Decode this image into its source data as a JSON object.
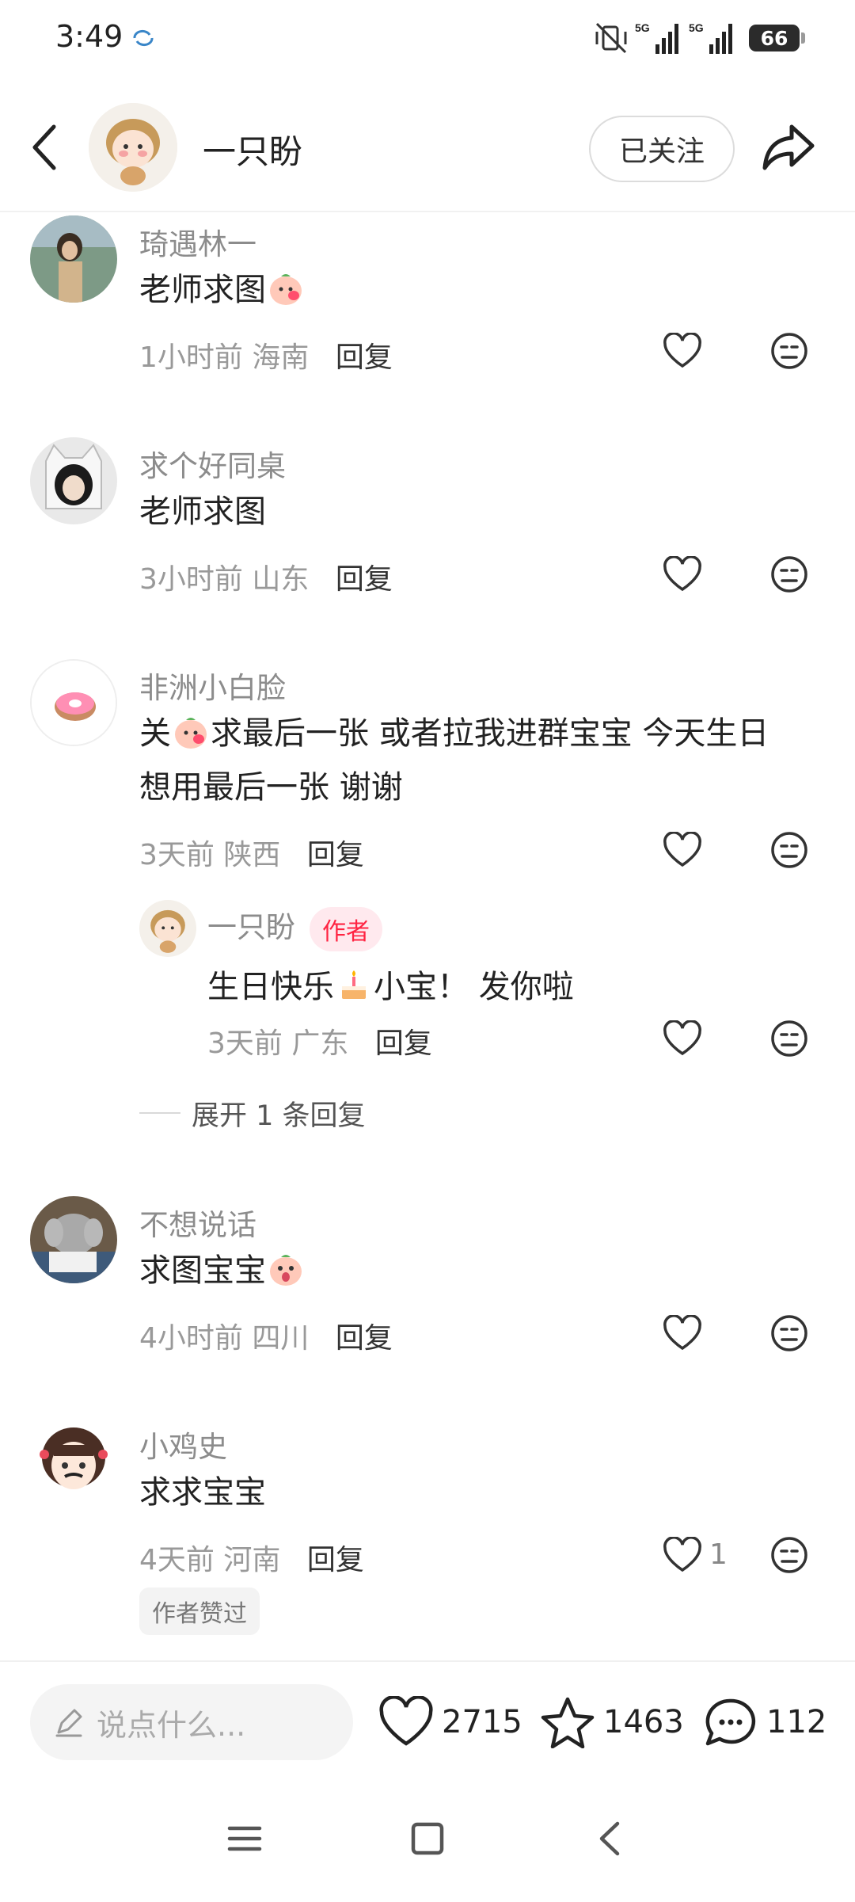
{
  "status_bar": {
    "time": "3:49",
    "battery": "66",
    "network": "5G"
  },
  "header": {
    "author_name": "一只盼",
    "follow_label": "已关注"
  },
  "comments": [
    {
      "name": "琦遇林一",
      "text": "老师求图",
      "time": "1小时前",
      "location": "海南",
      "reply": "回复"
    },
    {
      "name": "求个好同桌",
      "text": "老师求图",
      "time": "3小时前",
      "location": "山东",
      "reply": "回复"
    },
    {
      "name": "非洲小白脸",
      "text_part1": "关",
      "text_part2": "求最后一张 或者拉我进群宝宝 今天生日",
      "text_line2": "想用最后一张 谢谢",
      "time": "3天前",
      "location": "陕西",
      "reply": "回复",
      "sub_reply": {
        "name": "一只盼",
        "tag": "作者",
        "text_part1": "生日快乐",
        "text_part2": "小宝！ 发你啦",
        "time": "3天前",
        "location": "广东",
        "reply": "回复"
      },
      "expand_label": "展开 1 条回复"
    },
    {
      "name": "不想说话",
      "text": "求图宝宝",
      "time": "4小时前",
      "location": "四川",
      "reply": "回复"
    },
    {
      "name": "小鸡史",
      "text": "求求宝宝",
      "time": "4天前",
      "location": "河南",
      "reply": "回复",
      "likes": "1",
      "badge": "作者赞过"
    }
  ],
  "bottom_bar": {
    "input_placeholder": "说点什么...",
    "likes": "2715",
    "collects": "1463",
    "comments": "112"
  },
  "colors": {
    "accent": "#ff2442",
    "tag_bg": "#ffe9ee"
  }
}
